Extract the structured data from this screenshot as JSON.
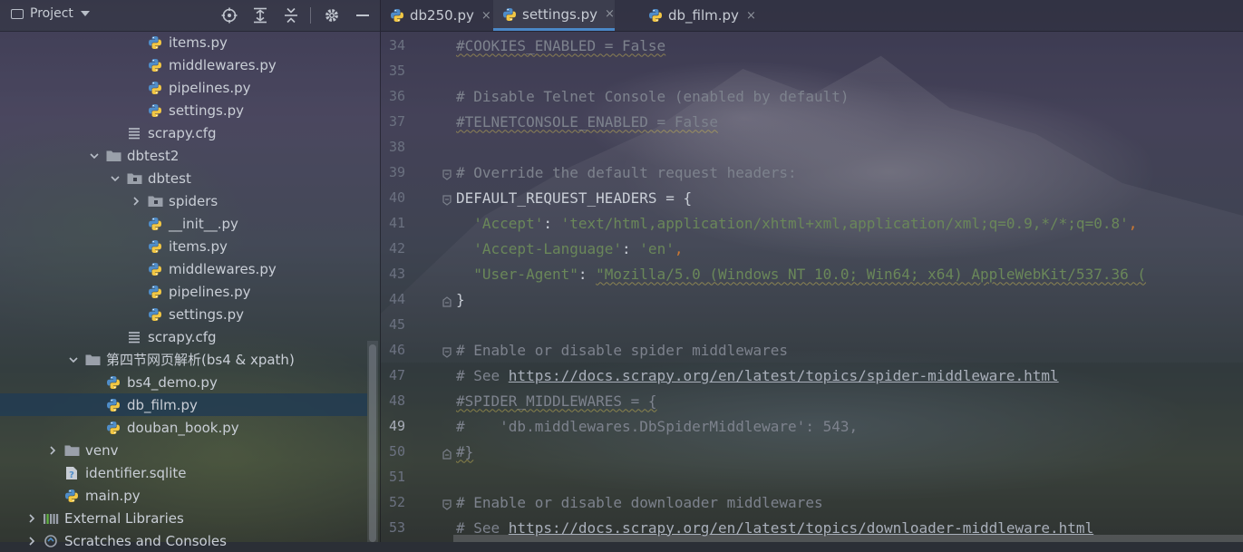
{
  "sidebar": {
    "header": {
      "title": "Project",
      "tools": [
        "locate-icon",
        "expand-all-icon",
        "collapse-all-icon",
        "gear-icon",
        "minimize-icon"
      ]
    },
    "tree": [
      {
        "label": "items.py",
        "kind": "py",
        "depth": 3
      },
      {
        "label": "middlewares.py",
        "kind": "py",
        "depth": 3
      },
      {
        "label": "pipelines.py",
        "kind": "py",
        "depth": 3
      },
      {
        "label": "settings.py",
        "kind": "py",
        "depth": 3
      },
      {
        "label": "scrapy.cfg",
        "kind": "cfg",
        "depth": 2
      },
      {
        "label": "dbtest2",
        "kind": "folder",
        "depth": 1,
        "expanded": true
      },
      {
        "label": "dbtest",
        "kind": "pkg",
        "depth": 2,
        "expanded": true
      },
      {
        "label": "spiders",
        "kind": "pkg",
        "depth": 3,
        "expanded": false
      },
      {
        "label": "__init__.py",
        "kind": "py",
        "depth": 3
      },
      {
        "label": "items.py",
        "kind": "py",
        "depth": 3
      },
      {
        "label": "middlewares.py",
        "kind": "py",
        "depth": 3
      },
      {
        "label": "pipelines.py",
        "kind": "py",
        "depth": 3
      },
      {
        "label": "settings.py",
        "kind": "py",
        "depth": 3
      },
      {
        "label": "scrapy.cfg",
        "kind": "cfg",
        "depth": 2
      },
      {
        "label": "第四节网页解析(bs4 & xpath)",
        "kind": "folder",
        "depth": 0,
        "expanded": true
      },
      {
        "label": "bs4_demo.py",
        "kind": "py",
        "depth": 1
      },
      {
        "label": "db_film.py",
        "kind": "py",
        "depth": 1,
        "selected": true
      },
      {
        "label": "douban_book.py",
        "kind": "py",
        "depth": 1
      },
      {
        "label": "venv",
        "kind": "folder",
        "depth": -1,
        "expanded": false
      },
      {
        "label": "identifier.sqlite",
        "kind": "sqlite",
        "depth": -1
      },
      {
        "label": "main.py",
        "kind": "py",
        "depth": -1
      },
      {
        "label": "External Libraries",
        "kind": "lib",
        "depth": -2,
        "expanded": false
      },
      {
        "label": "Scratches and Consoles",
        "kind": "scratch",
        "depth": -2,
        "expanded": false
      }
    ]
  },
  "tabs": [
    {
      "label": "db250.py",
      "close": "×",
      "active": false
    },
    {
      "label": "settings.py",
      "close": "×",
      "active": true
    },
    {
      "label": "db_film.py",
      "close": "×",
      "active": false
    }
  ],
  "editor": {
    "current_line": 49,
    "lines": [
      {
        "n": 34,
        "fold": "",
        "parts": [
          [
            "c-comment c-wavy",
            "#COOKIES_ENABLED = False"
          ]
        ]
      },
      {
        "n": 35,
        "fold": "",
        "parts": []
      },
      {
        "n": 36,
        "fold": "",
        "parts": [
          [
            "c-comment",
            "# Disable Telnet Console (enabled by default)"
          ]
        ]
      },
      {
        "n": 37,
        "fold": "",
        "parts": [
          [
            "c-comment c-wavy",
            "#TELNETCONSOLE_ENABLED = False"
          ]
        ]
      },
      {
        "n": 38,
        "fold": "",
        "parts": []
      },
      {
        "n": 39,
        "fold": "open",
        "parts": [
          [
            "c-comment",
            "# Override the default request headers:"
          ]
        ]
      },
      {
        "n": 40,
        "fold": "open",
        "parts": [
          [
            "c-ident",
            "DEFAULT_REQUEST_HEADERS = {"
          ]
        ]
      },
      {
        "n": 41,
        "fold": "",
        "parts": [
          [
            "c-punc",
            "  "
          ],
          [
            "c-str",
            "'Accept'"
          ],
          [
            "c-punc",
            ": "
          ],
          [
            "c-str",
            "'text/html,application/xhtml+xml,application/xml;q=0.9,*/*;q=0.8'"
          ],
          [
            "c-orange",
            ","
          ]
        ]
      },
      {
        "n": 42,
        "fold": "",
        "parts": [
          [
            "c-punc",
            "  "
          ],
          [
            "c-str",
            "'Accept-Language'"
          ],
          [
            "c-punc",
            ": "
          ],
          [
            "c-str",
            "'en'"
          ],
          [
            "c-orange",
            ","
          ]
        ]
      },
      {
        "n": 43,
        "fold": "",
        "parts": [
          [
            "c-punc",
            "  "
          ],
          [
            "c-str",
            "\"User-Agent\""
          ],
          [
            "c-punc",
            ": "
          ],
          [
            "c-str c-wavy",
            "\"Mozilla/5.0 (Windows NT 10.0; Win64; x64) AppleWebKit/537.36 ("
          ]
        ]
      },
      {
        "n": 44,
        "fold": "close",
        "parts": [
          [
            "c-ident",
            "}"
          ]
        ]
      },
      {
        "n": 45,
        "fold": "",
        "parts": []
      },
      {
        "n": 46,
        "fold": "open",
        "parts": [
          [
            "c-comment",
            "# Enable or disable spider middlewares"
          ]
        ]
      },
      {
        "n": 47,
        "fold": "",
        "parts": [
          [
            "c-comment",
            "# See "
          ],
          [
            "c-url",
            "https://docs.scrapy.org/en/latest/topics/spider-middleware.html"
          ]
        ]
      },
      {
        "n": 48,
        "fold": "",
        "parts": [
          [
            "c-comment c-wavy",
            "#SPIDER_MIDDLEWARES = {"
          ]
        ]
      },
      {
        "n": 49,
        "fold": "",
        "parts": [
          [
            "c-comment",
            "#    'db.middlewares.DbSpiderMiddleware': 543,"
          ]
        ]
      },
      {
        "n": 50,
        "fold": "close",
        "parts": [
          [
            "c-comment c-wavy",
            "#}"
          ]
        ]
      },
      {
        "n": 51,
        "fold": "",
        "parts": []
      },
      {
        "n": 52,
        "fold": "open",
        "parts": [
          [
            "c-comment",
            "# Enable or disable downloader middlewares"
          ]
        ]
      },
      {
        "n": 53,
        "fold": "",
        "parts": [
          [
            "c-comment",
            "# See "
          ],
          [
            "c-url",
            "https://docs.scrapy.org/en/latest/topics/downloader-middleware.html"
          ]
        ]
      }
    ]
  }
}
